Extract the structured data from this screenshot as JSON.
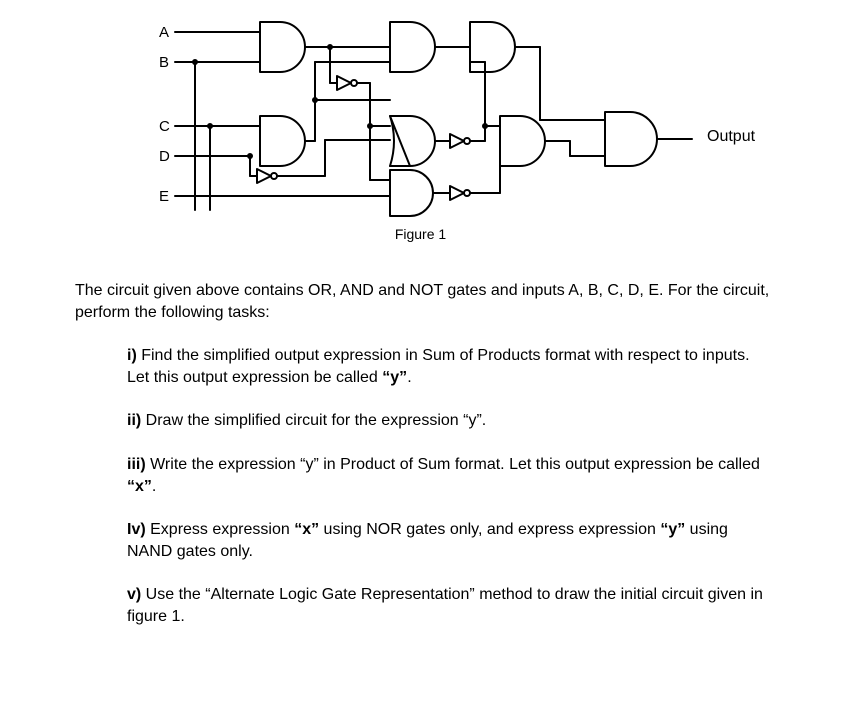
{
  "circuit": {
    "inputs": [
      "A",
      "B",
      "C",
      "D",
      "E"
    ],
    "output_label": "Output",
    "caption": "Figure 1"
  },
  "intro": "The circuit given above contains OR, AND and NOT gates and inputs A, B, C, D, E. For the circuit, perform the following tasks:",
  "tasks": {
    "i": {
      "num": "i)",
      "pre": " Find the simplified output expression in Sum of Products format with respect to inputs. Let this output expression be called ",
      "q1": "“y”",
      "post": "."
    },
    "ii": {
      "num": "ii)",
      "text": " Draw the simplified circuit for the expression “y”."
    },
    "iii": {
      "num": "iii)",
      "pre": " Write the expression “y” in Product of Sum format. Let this output expression be called ",
      "q1": "“x”",
      "post": "."
    },
    "iv": {
      "num": "Iv)",
      "s1": " Express expression ",
      "x": "“x”",
      "s2": " using NOR gates only, and express expression ",
      "y": "“y”",
      "s3": " using NAND gates only."
    },
    "v": {
      "num": "v)",
      "text": " Use the “Alternate Logic Gate Representation” method to draw the initial circuit given in figure 1."
    }
  }
}
